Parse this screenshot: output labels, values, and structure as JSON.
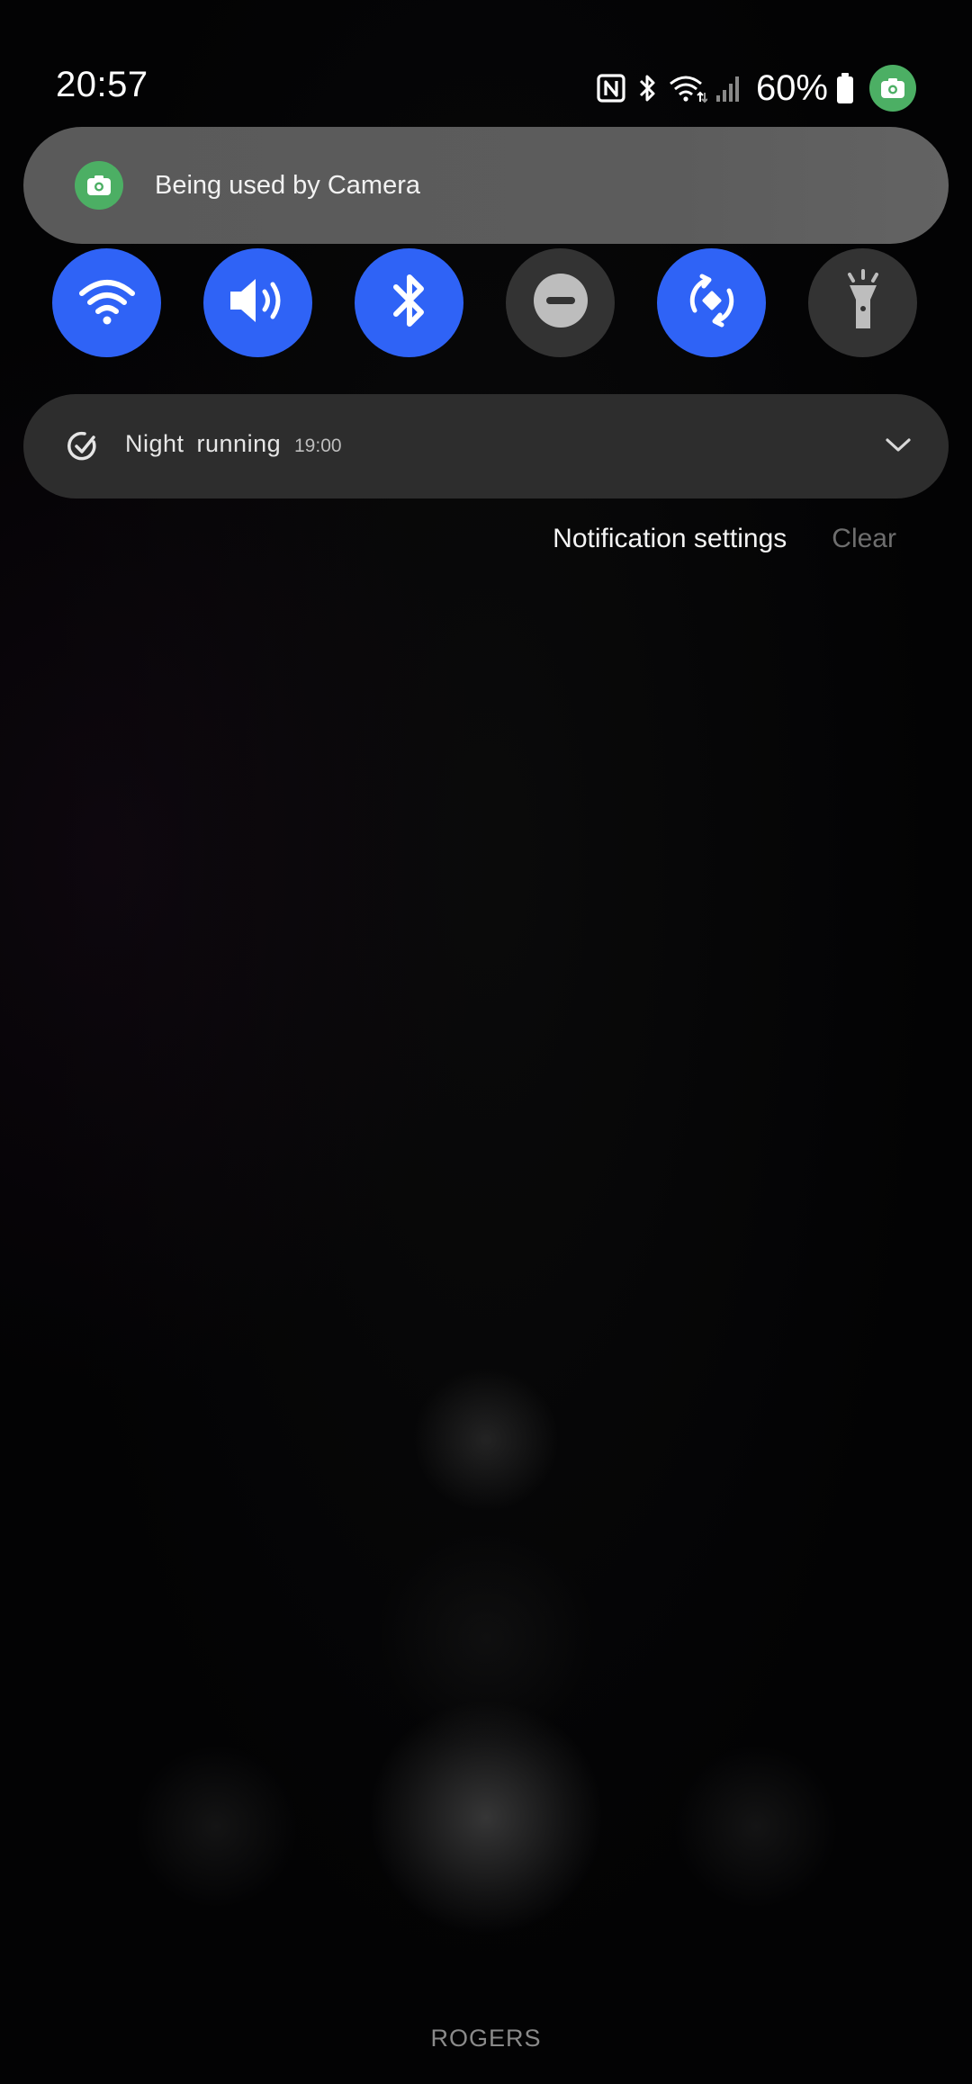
{
  "status_bar": {
    "time": "20:57",
    "battery_percent": "60%",
    "icons": [
      "nfc-icon",
      "bluetooth-icon",
      "wifi-icon",
      "signal-icon",
      "battery-icon",
      "camera-in-use-icon"
    ]
  },
  "privacy_chip": {
    "label": "Being used by Camera",
    "icon": "camera-icon",
    "color": "#4caf64"
  },
  "quick_toggles": [
    {
      "name": "wifi",
      "icon": "wifi-icon",
      "state": "on"
    },
    {
      "name": "sound",
      "icon": "speaker-icon",
      "state": "on"
    },
    {
      "name": "bluetooth",
      "icon": "bluetooth-icon",
      "state": "on"
    },
    {
      "name": "do-not-disturb",
      "icon": "minus-circle-icon",
      "state": "off"
    },
    {
      "name": "auto-rotate",
      "icon": "rotate-icon",
      "state": "on"
    },
    {
      "name": "flashlight",
      "icon": "flashlight-icon",
      "state": "off"
    }
  ],
  "notification": {
    "title": "Night running",
    "time": "19:00",
    "icon": "check-circle-icon"
  },
  "notification_actions": {
    "settings_label": "Notification settings",
    "clear_label": "Clear"
  },
  "carrier": "ROGERS",
  "colors": {
    "accent": "#2f63f6",
    "toggle_off": "#333333",
    "camera_green": "#4caf64"
  }
}
